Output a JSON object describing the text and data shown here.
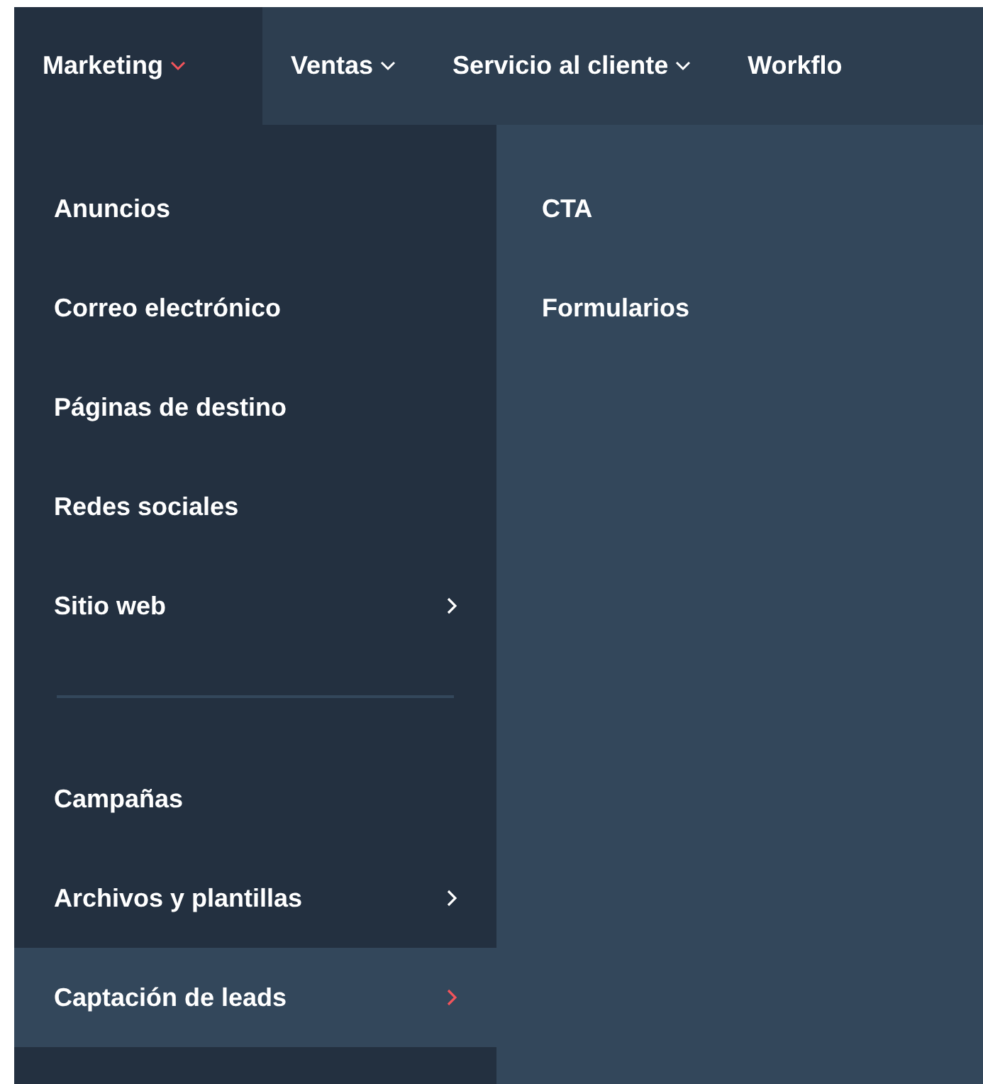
{
  "nav_tabs": [
    {
      "label": "Marketing",
      "selected": true,
      "has_caret": true
    },
    {
      "label": "Ventas",
      "selected": false,
      "has_caret": true
    },
    {
      "label": "Servicio al cliente",
      "selected": false,
      "has_caret": true
    },
    {
      "label": "Workflo",
      "selected": false,
      "has_caret": false
    }
  ],
  "menu_groups": [
    [
      {
        "label": "Anuncios",
        "submenu": false,
        "selected": false
      },
      {
        "label": "Correo electrónico",
        "submenu": false,
        "selected": false
      },
      {
        "label": "Páginas de destino",
        "submenu": false,
        "selected": false
      },
      {
        "label": "Redes sociales",
        "submenu": false,
        "selected": false
      },
      {
        "label": "Sitio web",
        "submenu": true,
        "selected": false
      }
    ],
    [
      {
        "label": "Campañas",
        "submenu": false,
        "selected": false
      },
      {
        "label": "Archivos y plantillas",
        "submenu": true,
        "selected": false
      },
      {
        "label": "Captación de leads",
        "submenu": true,
        "selected": true
      }
    ]
  ],
  "submenu_items": [
    "CTA",
    "Formularios"
  ]
}
